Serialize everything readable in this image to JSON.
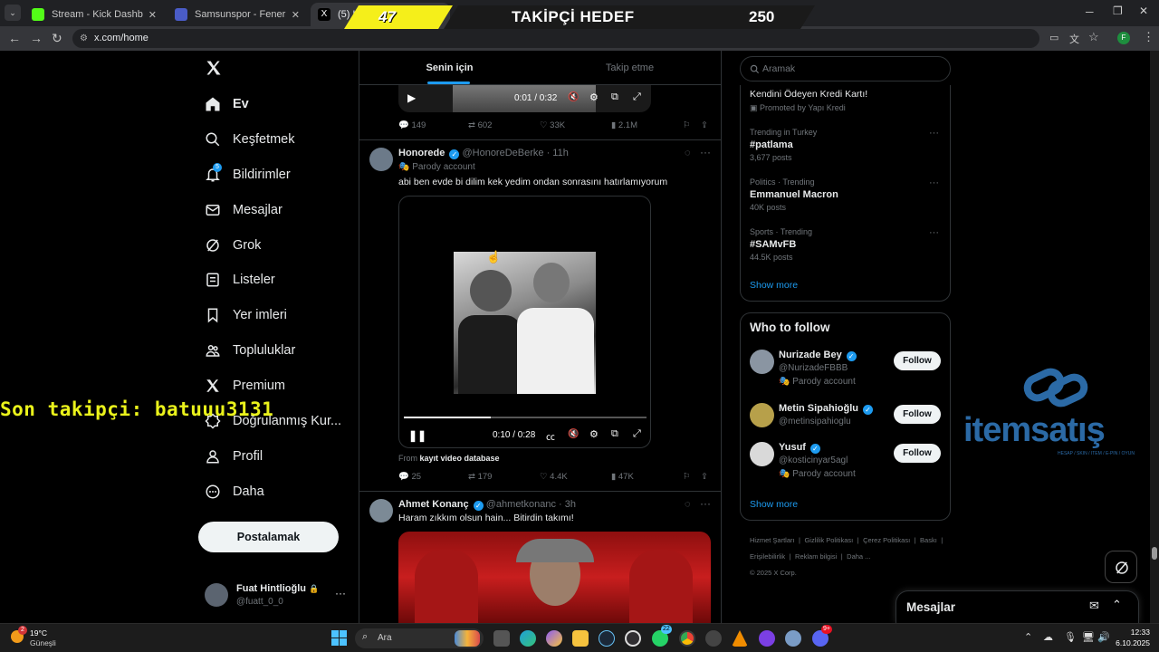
{
  "browser": {
    "tabs": [
      {
        "title": "Stream - Kick Dashboard",
        "color": "#53fc18"
      },
      {
        "title": "Samsunspor - Fenerbahçe canlı",
        "color": "#4a5cc7"
      },
      {
        "title": "(5) Hom",
        "color": "#000000"
      }
    ],
    "url": "x.com/home"
  },
  "overlay": {
    "counter": "47",
    "goal_label": "TAKİPÇİ HEDEF",
    "goal_value": "250",
    "last_follower": "Son takipçi: batuuu3131",
    "sponsor": "itemsatış",
    "sponsor_tagline": "HESAP / SKIN / ITEM / E-PIN / OYUN"
  },
  "nav": {
    "items": [
      {
        "label": "Ev",
        "icon": "home-icon"
      },
      {
        "label": "Keşfetmek",
        "icon": "search-icon"
      },
      {
        "label": "Bildirimler",
        "icon": "bell-icon",
        "badge": "5"
      },
      {
        "label": "Mesajlar",
        "icon": "envelope-icon"
      },
      {
        "label": "Grok",
        "icon": "grok-icon"
      },
      {
        "label": "Listeler",
        "icon": "list-icon"
      },
      {
        "label": "Yer imleri",
        "icon": "bookmark-icon"
      },
      {
        "label": "Topluluklar",
        "icon": "communities-icon"
      },
      {
        "label": "Premium",
        "icon": "x-icon"
      },
      {
        "label": "Doğrulanmış Kur...",
        "icon": "verified-org-icon"
      },
      {
        "label": "Profil",
        "icon": "person-icon"
      },
      {
        "label": "Daha",
        "icon": "more-circle-icon"
      }
    ],
    "post_label": "Postalamak",
    "account": {
      "name": "Fuat Hintlioğlu",
      "handle": "@fuatt_0_0"
    }
  },
  "feed": {
    "tabs": [
      "Senin için",
      "Takip etme"
    ],
    "top_video": {
      "time": "0:01 / 0:32",
      "stats": {
        "replies": "149",
        "reposts": "602",
        "likes": "33K",
        "views": "2.1M"
      }
    },
    "tweet1": {
      "name": "Honorede",
      "handle": "@HonoreDeBerke",
      "time": "· 11h",
      "parody": "Parody account",
      "text": "abi ben evde bi dilim kek yedim ondan sonrasını hatırlamıyorum",
      "video_time": "0:10 / 0:28",
      "video_progress": 0.36,
      "from_prefix": "From",
      "from_source": "kayıt video database",
      "stats": {
        "replies": "25",
        "reposts": "179",
        "likes": "4.4K",
        "views": "47K"
      }
    },
    "tweet2": {
      "name": "Ahmet Konanç",
      "handle": "@ahmetkonanc",
      "time": "· 3h",
      "text": "Haram zıkkım olsun hain... Bitirdin takımı!"
    }
  },
  "sidebar": {
    "search_placeholder": "Aramak",
    "promo": {
      "title": "Kendini Ödeyen Kredi Kartı!",
      "promoted": "Promoted by Yapı Kredi"
    },
    "trends": [
      {
        "meta": "Trending in Turkey",
        "title": "#patlama",
        "count": "3,677 posts"
      },
      {
        "meta": "Politics · Trending",
        "title": "Emmanuel Macron",
        "count": "40K posts"
      },
      {
        "meta": "Sports · Trending",
        "title": "#SAMvFB",
        "count": "44.5K posts"
      }
    ],
    "show_more": "Show more",
    "who_to_follow_title": "Who to follow",
    "who_to_follow": [
      {
        "name": "Nurizade Bey",
        "handle": "@NurizadeFBBB",
        "parody": "Parody account"
      },
      {
        "name": "Metin Sipahioğlu",
        "handle": "@metinsipahioglu",
        "parody": ""
      },
      {
        "name": "Yusuf",
        "handle": "@kosticinyar5agl",
        "parody": "Parody account"
      }
    ],
    "follow_label": "Follow",
    "footer": [
      "Hizmet Şartları",
      "|",
      "Gizlilik Politikası",
      "|",
      "Çerez Politikası",
      "|",
      "Baskı",
      "|",
      "Erişilebilirlik",
      "|",
      "Reklam bilgisi",
      "|",
      "Daha ...",
      "© 2025 X Corp."
    ],
    "messages_label": "Mesajlar"
  },
  "taskbar": {
    "weather_temp": "19°C",
    "weather_desc": "Güneşli",
    "weather_badge": "2",
    "search_placeholder": "Ara",
    "time": "12:33",
    "date": "6.10.2025",
    "whatsapp_badge": "22",
    "discord_badge": "9+"
  }
}
